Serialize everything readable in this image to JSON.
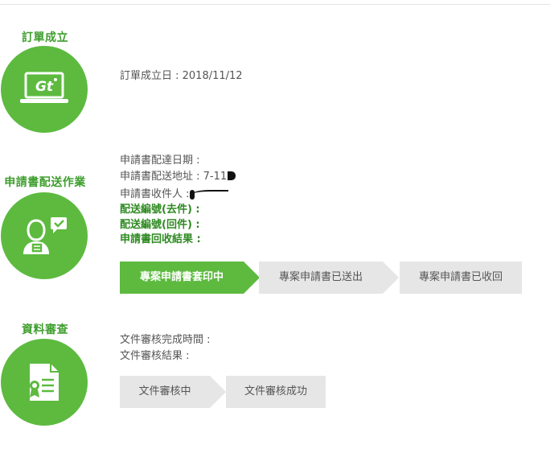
{
  "stages": {
    "order": {
      "title": "訂單成立",
      "icon": "laptop-gt-logo-icon",
      "lines": [
        "訂單成立日 : 2018/11/12"
      ]
    },
    "delivery": {
      "title": "申請書配送作業",
      "icon": "person-with-document-icon",
      "date_line": "申請書配達日期 :",
      "address_line": "申請書配送地址 : 7-11",
      "recipient_line": "申請書收件人 :",
      "outgoing_no": "配送編號(去件) :",
      "return_no": "配送編號(回件) :",
      "return_result": "申請書回收結果 :",
      "steps": [
        "專案申請書套印中",
        "專案申請書已送出",
        "專案申請書已收回"
      ],
      "active_step": 0
    },
    "review": {
      "title": "資料審查",
      "icon": "certificate-document-icon",
      "complete_time": "文件審核完成時間 :",
      "result": "文件審核結果 :",
      "steps": [
        "文件審核中",
        "文件審核成功"
      ],
      "active_step": -1
    }
  },
  "colors": {
    "brand_green": "#5dba3f",
    "title_green": "#3f9e2e",
    "step_active": "#5dba3f",
    "step_inactive": "#e6e6e6"
  }
}
